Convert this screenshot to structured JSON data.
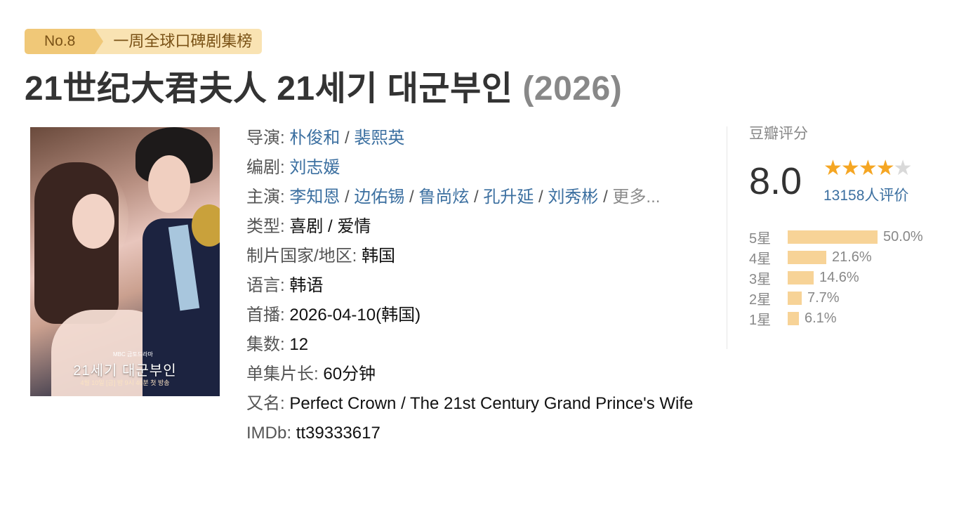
{
  "badge": {
    "rank": "No.8",
    "list": "一周全球口碑剧集榜"
  },
  "title": {
    "name": "21世纪大君夫人 21세기 대군부인",
    "year": "(2026)"
  },
  "poster": {
    "title": "21세기 대군부인",
    "sub": "4월 10일 [금] 밤 9시 40분 첫 방송",
    "logo": "MBC 금토드라마"
  },
  "info": {
    "director_label": "导演:",
    "directors": [
      "朴俊和",
      "裴熙英"
    ],
    "writer_label": "编剧:",
    "writers": [
      "刘志媛"
    ],
    "cast_label": "主演:",
    "cast": [
      "李知恩",
      "边佑锡",
      "鲁尚炫",
      "孔升延",
      "刘秀彬"
    ],
    "more": "更多...",
    "sep": " / ",
    "genre_label": "类型:",
    "genre": "喜剧 / 爱情",
    "country_label": "制片国家/地区:",
    "country": "韩国",
    "language_label": "语言:",
    "language": "韩语",
    "premiere_label": "首播:",
    "premiere": "2026-04-10(韩国)",
    "episodes_label": "集数:",
    "episodes": "12",
    "runtime_label": "单集片长:",
    "runtime": "60分钟",
    "aka_label": "又名:",
    "aka": "Perfect Crown / The 21st Century Grand Prince's Wife",
    "imdb_label": "IMDb:",
    "imdb": "tt39333617"
  },
  "rating": {
    "label": "豆瓣评分",
    "score": "8.0",
    "stars_filled": 4,
    "stars_total": 5,
    "count": "13158人评价",
    "accent_color": "#f5a623",
    "bar_color": "#f7d397",
    "distribution": [
      {
        "label": "5星",
        "pct": "50.0%",
        "value": 50.0
      },
      {
        "label": "4星",
        "pct": "21.6%",
        "value": 21.6
      },
      {
        "label": "3星",
        "pct": "14.6%",
        "value": 14.6
      },
      {
        "label": "2星",
        "pct": "7.7%",
        "value": 7.7
      },
      {
        "label": "1星",
        "pct": "6.1%",
        "value": 6.1
      }
    ]
  }
}
